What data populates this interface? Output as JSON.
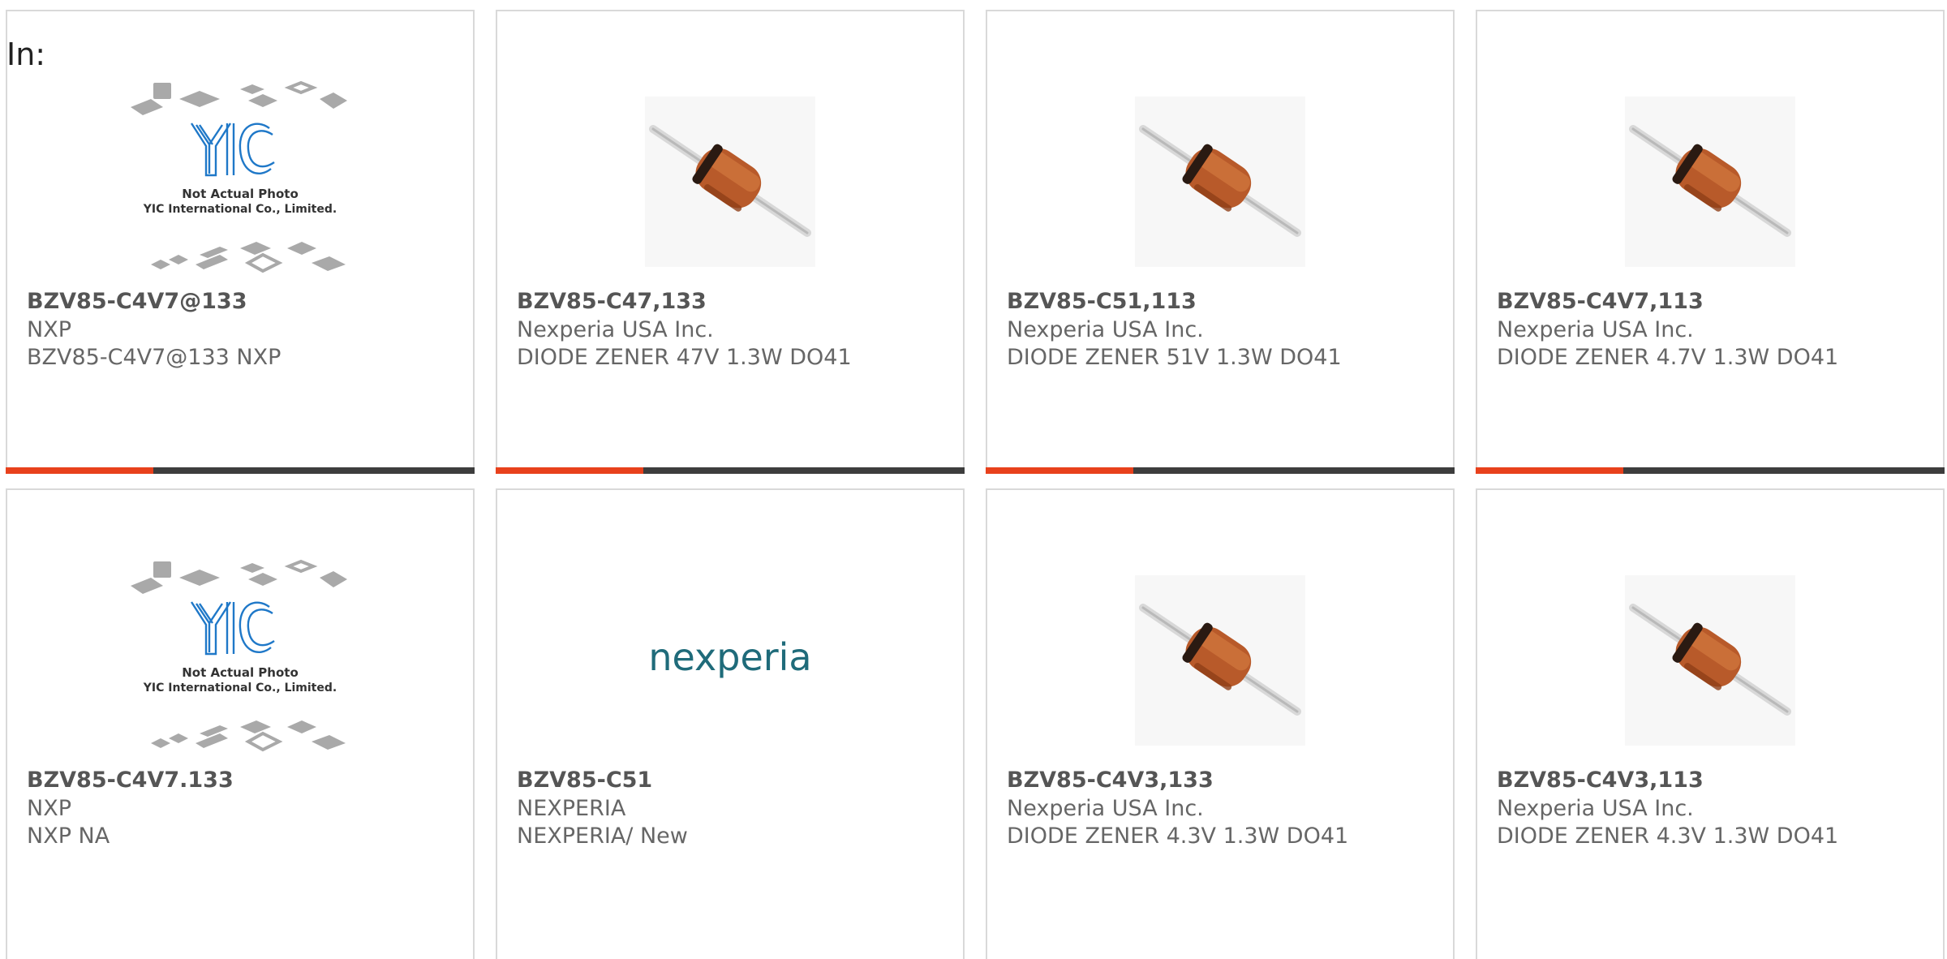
{
  "page": {
    "section_label": "In:"
  },
  "accent_color": "#e8411c",
  "bar_color": "#3d3d3d",
  "products": [
    {
      "part": "BZV85-C4V7@133",
      "manufacturer": "NXP",
      "description": "BZV85-C4V7@133 NXP",
      "image": "yic-placeholder-icon",
      "image_caption": [
        "Not Actual Photo",
        "YIC International Co., Limited."
      ]
    },
    {
      "part": "BZV85-C47,133",
      "manufacturer": "Nexperia USA Inc.",
      "description": "DIODE ZENER 47V 1.3W DO41",
      "image": "zener-diode-icon"
    },
    {
      "part": "BZV85-C51,113",
      "manufacturer": "Nexperia USA Inc.",
      "description": "DIODE ZENER 51V 1.3W DO41",
      "image": "zener-diode-icon"
    },
    {
      "part": "BZV85-C4V7,113",
      "manufacturer": "Nexperia USA Inc.",
      "description": "DIODE ZENER 4.7V 1.3W DO41",
      "image": "zener-diode-icon"
    },
    {
      "part": "BZV85-C4V7.133",
      "manufacturer": "NXP",
      "description": "NXP NA",
      "image": "yic-placeholder-icon",
      "image_caption": [
        "Not Actual Photo",
        "YIC International Co., Limited."
      ]
    },
    {
      "part": "BZV85-C51",
      "manufacturer": "NEXPERIA",
      "description": "NEXPERIA/ New",
      "image": "nexperia-logo",
      "logo_text": "nexperia"
    },
    {
      "part": "BZV85-C4V3,133",
      "manufacturer": "Nexperia USA Inc.",
      "description": "DIODE ZENER 4.3V 1.3W DO41",
      "image": "zener-diode-icon"
    },
    {
      "part": "BZV85-C4V3,113",
      "manufacturer": "Nexperia USA Inc.",
      "description": "DIODE ZENER 4.3V 1.3W DO41",
      "image": "zener-diode-icon"
    }
  ]
}
